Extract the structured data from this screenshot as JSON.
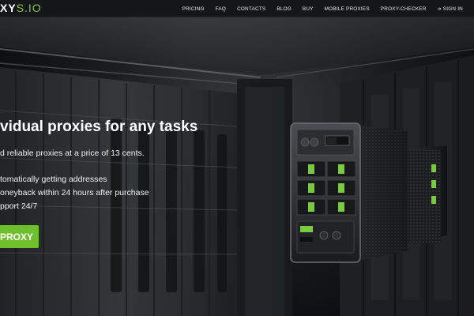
{
  "brand": {
    "logo_main": "XY",
    "logo_suffix": "S.IO",
    "accent": "#8bc34a"
  },
  "nav": {
    "items": [
      "PRICING",
      "FAQ",
      "CONTACTS",
      "BLOG",
      "BUY",
      "MOBILE PROXIES",
      "PROXY-CHECKER"
    ],
    "signin_label": "SIGN IN",
    "signin_icon": "sign-in-icon"
  },
  "hero": {
    "title": "vidual proxies for any tasks",
    "subtitle": "d reliable proxies at a price of 13 cents.",
    "features": [
      "tomatically getting addresses",
      "oneyback within 24 hours after purchase",
      "pport 24/7"
    ],
    "cta_label": "PROXY",
    "cta_color": "#6fbf2c"
  }
}
